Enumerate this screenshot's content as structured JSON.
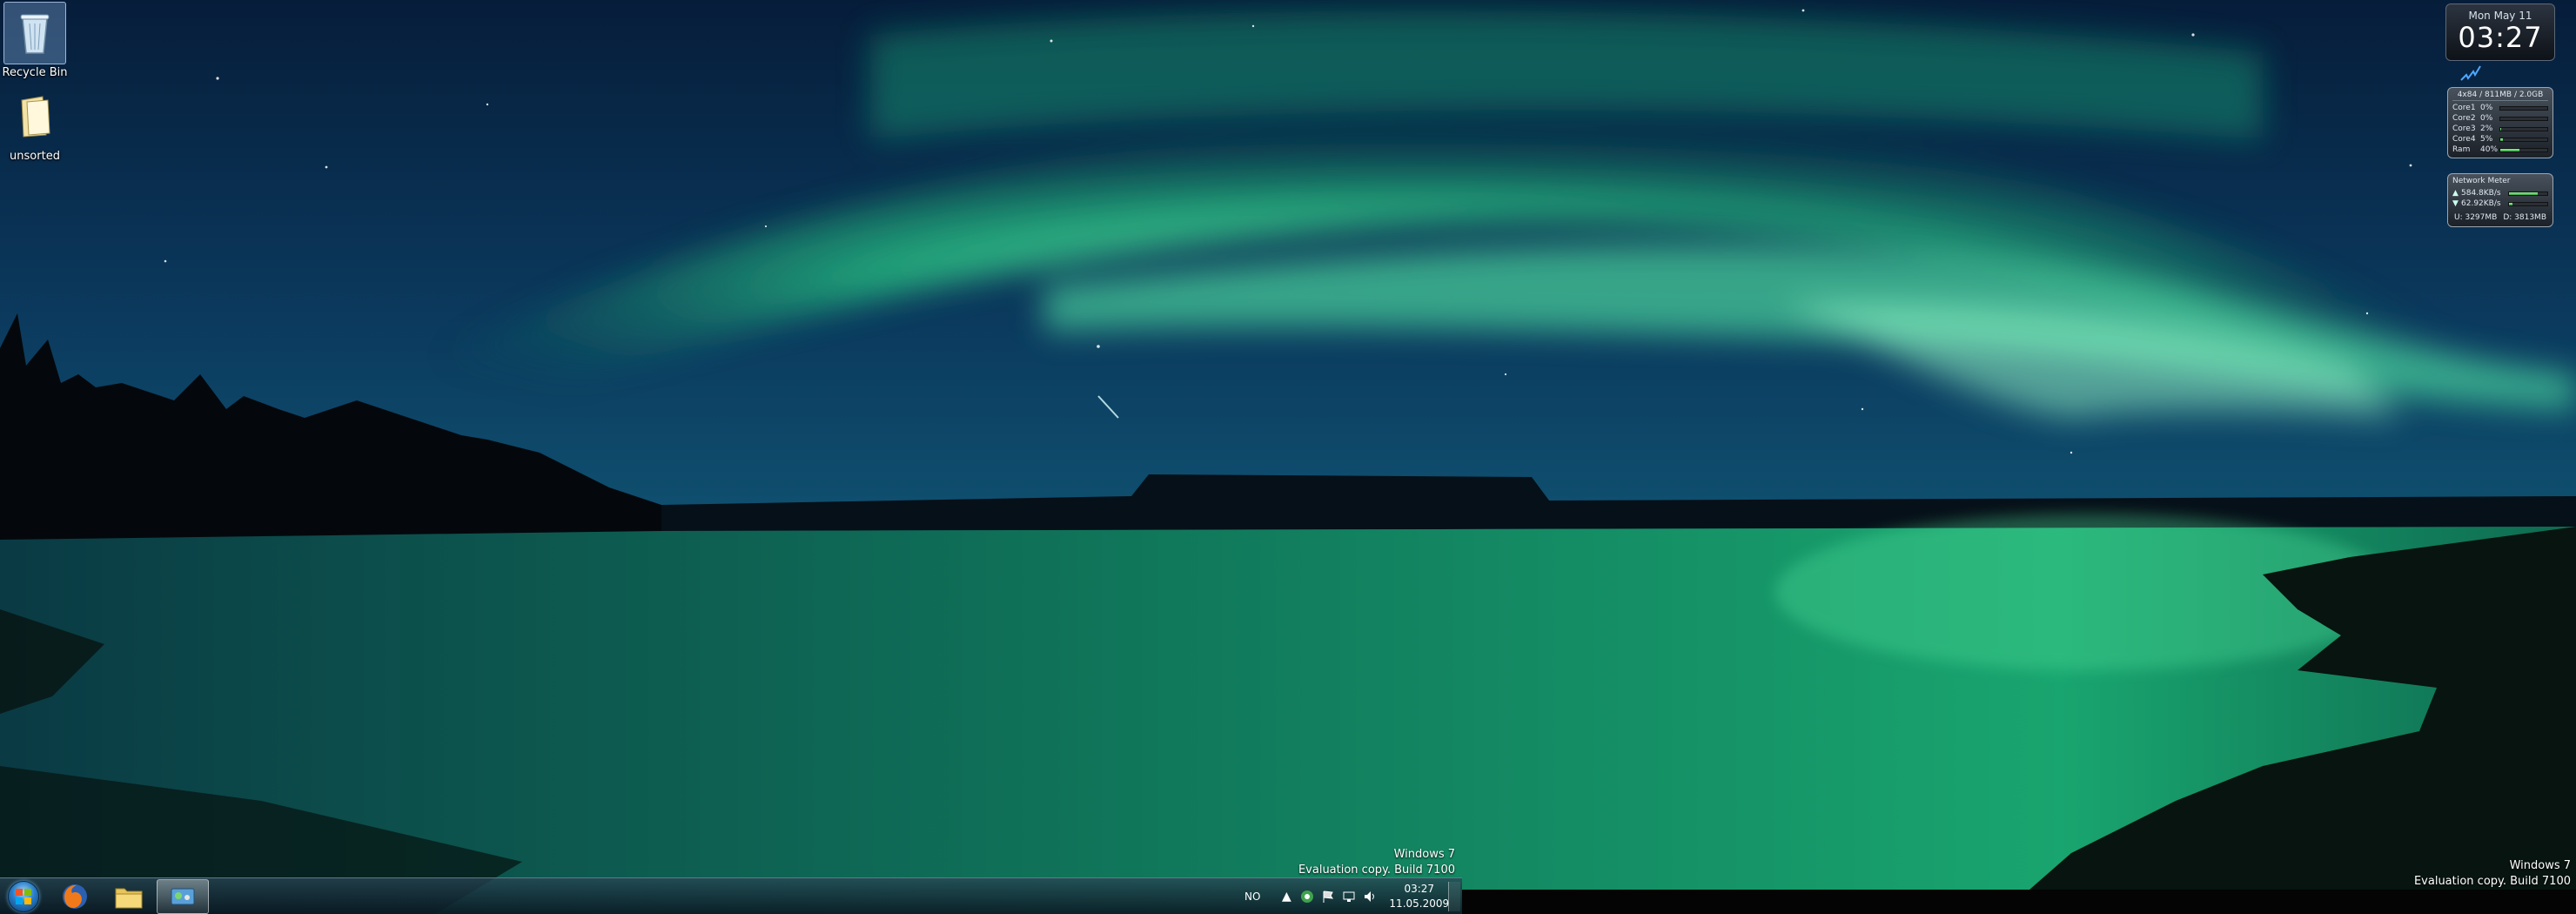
{
  "desktop": {
    "icons": [
      {
        "label": "Recycle Bin",
        "icon": "recycle-bin-icon"
      },
      {
        "label": "unsorted",
        "icon": "folder-icon"
      }
    ]
  },
  "gadgets": {
    "clock": {
      "date": "Mon May 11",
      "time": "03:27"
    },
    "cpu_meter": {
      "header": "4x84 / 811MB / 2.0GB",
      "rows": [
        {
          "label": "Core1",
          "value": "0%",
          "level": 0
        },
        {
          "label": "Core2",
          "value": "0%",
          "level": 0
        },
        {
          "label": "Core3",
          "value": "2%",
          "level": 2
        },
        {
          "label": "Core4",
          "value": "5%",
          "level": 5
        },
        {
          "label": "Ram",
          "value": "40%",
          "level": 40
        }
      ]
    },
    "network_meter": {
      "title": "Network Meter",
      "upload_rate": "584.8KB/s",
      "download_rate": "62.92KB/s",
      "upload_total": "U: 3297MB",
      "download_total": "D: 3813MB"
    }
  },
  "watermark": {
    "line1": "Windows 7",
    "line2": "Evaluation copy. Build 7100"
  },
  "taskbar": {
    "start_icon": "windows-start-orb-icon",
    "pinned": [
      {
        "name": "firefox",
        "icon": "firefox-icon"
      },
      {
        "name": "explorer",
        "icon": "folder-icon"
      },
      {
        "name": "network",
        "icon": "network-app-icon"
      }
    ],
    "tray": {
      "language": "NO",
      "time": "03:27",
      "date": "11.05.2009",
      "icons": [
        "show-hidden-icon",
        "app-tray-icon",
        "action-center-flag-icon",
        "network-icon",
        "volume-icon"
      ]
    }
  },
  "colors": {
    "aurora": "#3dffa0",
    "sky": "#0d3b66",
    "water": "#0f8a6a"
  }
}
